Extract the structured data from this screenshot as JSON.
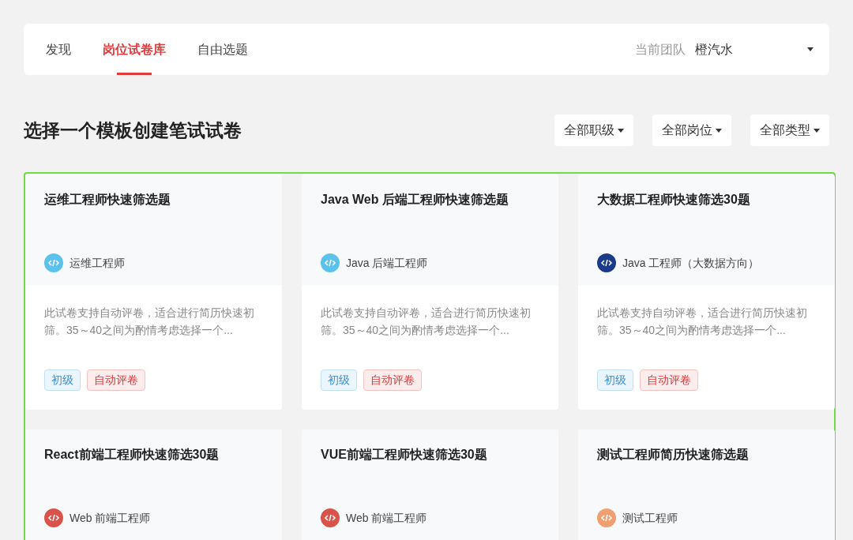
{
  "nav": {
    "tabs": [
      {
        "label": "发现",
        "selected": false
      },
      {
        "label": "岗位试卷库",
        "selected": true
      },
      {
        "label": "自由选题",
        "selected": false
      }
    ],
    "team_label": "当前团队",
    "team_value": "橙汽水"
  },
  "heading": "选择一个模板创建笔试试卷",
  "filters": [
    "全部职级",
    "全部岗位",
    "全部类型"
  ],
  "cards": [
    {
      "title": "运维工程师快速筛选题",
      "role": "运维工程师",
      "color": "#5bc2ec",
      "description": "此试卷支持自动评卷，适合进行简历快速初筛。35～40之间为酌情考虑选择一个...",
      "tags": [
        {
          "kind": "level",
          "label": "初级"
        },
        {
          "kind": "auto",
          "label": "自动评卷"
        }
      ]
    },
    {
      "title": "Java Web 后端工程师快速筛选题",
      "role": "Java 后端工程师",
      "color": "#5bc2ec",
      "description": "此试卷支持自动评卷，适合进行简历快速初筛。35～40之间为酌情考虑选择一个...",
      "tags": [
        {
          "kind": "level",
          "label": "初级"
        },
        {
          "kind": "auto",
          "label": "自动评卷"
        }
      ]
    },
    {
      "title": "大数据工程师快速筛选30题",
      "role": "Java 工程师（大数据方向）",
      "color": "#1b3a8a",
      "description": "此试卷支持自动评卷，适合进行简历快速初筛。35～40之间为酌情考虑选择一个...",
      "tags": [
        {
          "kind": "level",
          "label": "初级"
        },
        {
          "kind": "auto",
          "label": "自动评卷"
        }
      ]
    },
    {
      "title": "React前端工程师快速筛选30题",
      "role": "Web 前端工程师",
      "color": "#d9534a"
    },
    {
      "title": "VUE前端工程师快速筛选30题",
      "role": "Web 前端工程师",
      "color": "#d9534a"
    },
    {
      "title": "测试工程师简历快速筛选题",
      "role": "测试工程师",
      "color": "#f0a070"
    }
  ]
}
